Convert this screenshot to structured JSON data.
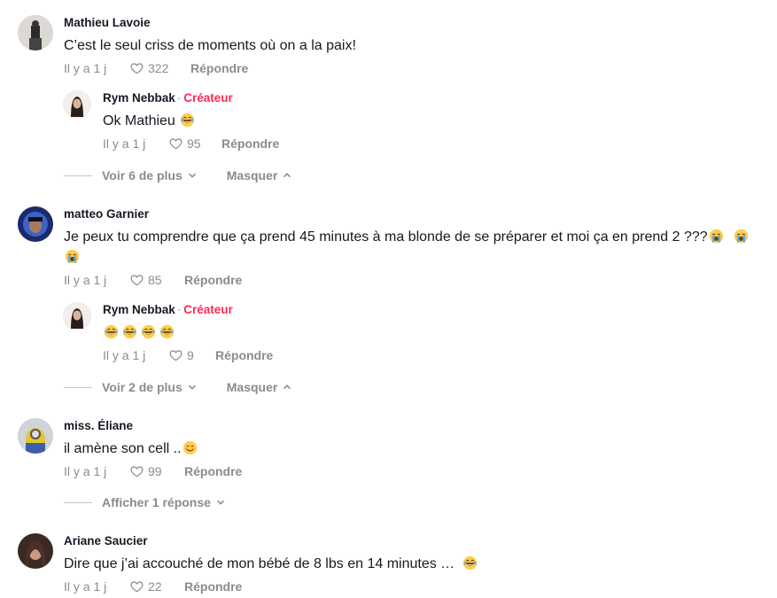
{
  "comments": [
    {
      "author": "Mathieu Lavoie",
      "text": "C’est le seul criss de moments où on a la paix!",
      "time": "Il y a 1 j",
      "likes": "322",
      "reply_label": "Répondre",
      "reply": {
        "author": "Rym Nebbak",
        "badge_sep": "·",
        "badge": "Créateur",
        "text": "Ok Mathieu",
        "emoji": "laughing-face",
        "time": "Il y a 1 j",
        "likes": "95",
        "reply_label": "Répondre"
      },
      "more_label": "Voir 6 de plus",
      "hide_label": "Masquer"
    },
    {
      "author": "matteo Garnier",
      "text": "Je peux tu comprendre que ça prend 45 minutes à ma blonde de se préparer et moi ça en prend 2 ???",
      "emoji": "crying-face",
      "time": "Il y a 1 j",
      "likes": "85",
      "reply_label": "Répondre",
      "reply": {
        "author": "Rym Nebbak",
        "badge_sep": "·",
        "badge": "Créateur",
        "text": "",
        "emoji": "laughing-face",
        "time": "Il y a 1 j",
        "likes": "9",
        "reply_label": "Répondre"
      },
      "more_label": "Voir 2 de plus",
      "hide_label": "Masquer"
    },
    {
      "author": "miss. Éliane",
      "text": "il amène son cell ..",
      "emoji": "smiling-face",
      "time": "Il y a 1 j",
      "likes": "99",
      "reply_label": "Répondre",
      "show_replies_label": "Afficher 1 réponse"
    },
    {
      "author": "Ariane Saucier",
      "text": "Dire que j’ai accouché de mon bébé de 8 lbs en 14 minutes …",
      "emoji": "laughing-face",
      "time": "Il y a 1 j",
      "likes": "22",
      "reply_label": "Répondre"
    }
  ],
  "colors": {
    "creator": "#fe2c55",
    "muted": "#8a8b91",
    "text": "#161823"
  }
}
